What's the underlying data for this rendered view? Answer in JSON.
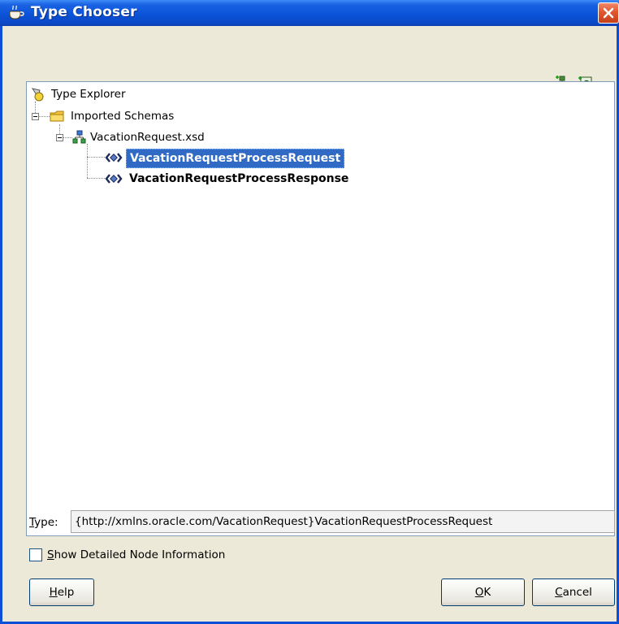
{
  "window": {
    "title": "Type Chooser"
  },
  "toolbar": {
    "icons": [
      "import-schema-icon",
      "import-wsdl-icon"
    ]
  },
  "tree": {
    "root": {
      "label": "Type Explorer",
      "icon": "type-explorer-icon"
    },
    "imported": {
      "label": "Imported Schemas",
      "icon": "folder-icon",
      "expanded": true
    },
    "schema": {
      "label": "VacationRequest.xsd",
      "icon": "schema-icon",
      "expanded": true
    },
    "elements": [
      {
        "label": "VacationRequestProcessRequest",
        "icon": "element-icon",
        "selected": true
      },
      {
        "label": "VacationRequestProcessResponse",
        "icon": "element-icon",
        "selected": false
      }
    ]
  },
  "type_field": {
    "label_mnemonic": "T",
    "label_rest": "ype:",
    "value": "{http://xmlns.oracle.com/VacationRequest}VacationRequestProcessRequest"
  },
  "show_detail": {
    "checked": false,
    "label_mnemonic": "S",
    "label_rest": "how Detailed Node Information"
  },
  "buttons": {
    "help": {
      "mnemonic": "H",
      "rest": "elp"
    },
    "ok": {
      "mnemonic": "O",
      "rest": "K"
    },
    "cancel": {
      "mnemonic": "C",
      "rest": "ancel"
    }
  },
  "colors": {
    "titlebar": "#0b53d8",
    "selection": "#316ac5",
    "close": "#e1572e",
    "dialog_bg": "#ece9d8"
  }
}
